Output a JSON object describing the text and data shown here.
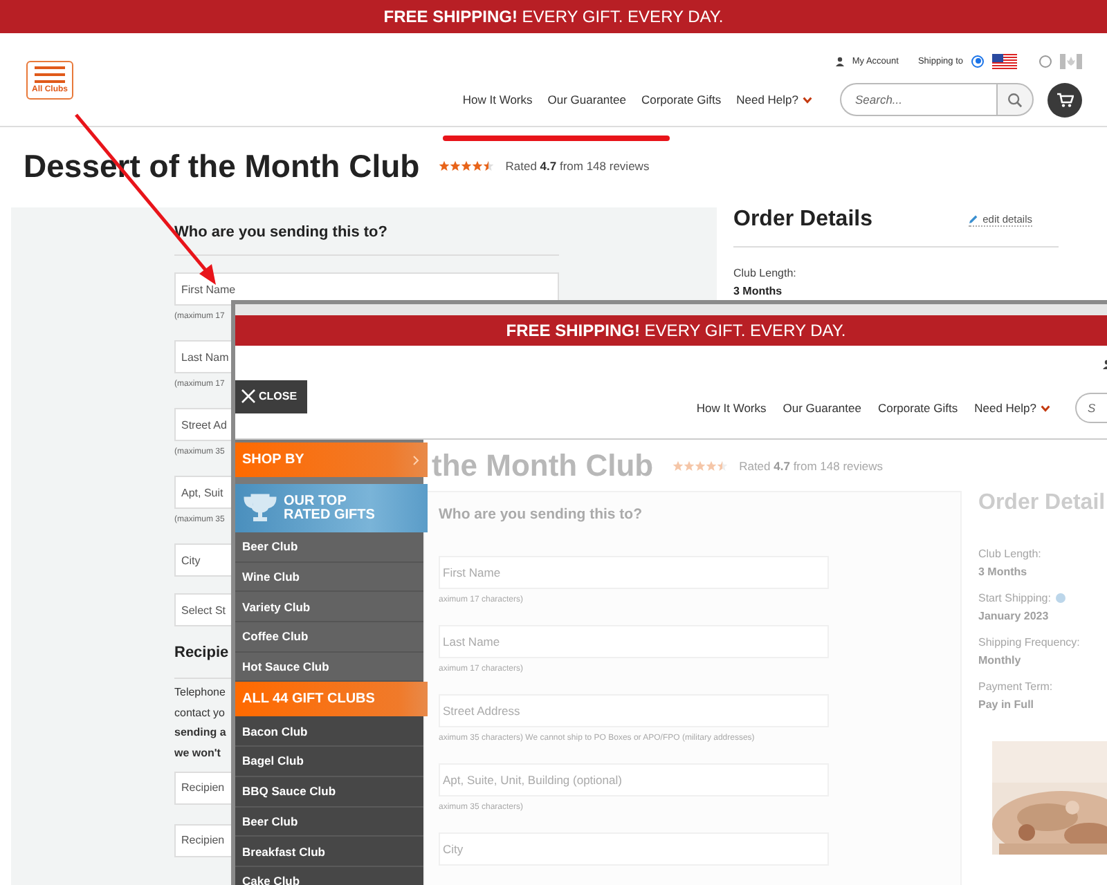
{
  "promo": "**FREE SHIPPING!** EVERY GIFT. EVERY DAY.",
  "header": {
    "menu_button": "All Clubs",
    "account": "My Account",
    "shipping_label": "Shipping to",
    "shipping_options": [
      {
        "kind": "us",
        "selected": true
      },
      {
        "kind": "ca",
        "selected": false
      }
    ],
    "nav": [
      "How It Works",
      "Our Guarantee",
      "Corporate Gifts",
      "Need Help?"
    ],
    "search": {
      "placeholder": "Search..."
    }
  },
  "title": "Dessert of the Month Club",
  "rating": {
    "stars": 4.5,
    "text": "Rated **4.7** from 148 reviews"
  },
  "form": {
    "heading": "Who are you sending this to?",
    "fields": [
      {
        "kind": "input",
        "placeholder": "First Name",
        "hint": "(maximum 17"
      },
      {
        "kind": "input",
        "placeholder": "Last Nam",
        "hint": "(maximum 17"
      },
      {
        "kind": "input",
        "placeholder": "Street Ad",
        "hint": "(maximum 35"
      },
      {
        "kind": "input",
        "placeholder": "Apt, Suit",
        "hint": "(maximum 35"
      },
      {
        "kind": "input",
        "placeholder": "City"
      },
      {
        "kind": "select",
        "placeholder": "Select St"
      }
    ],
    "section": "Recipie",
    "lines": [
      {
        "text": "Telephone",
        "bold": false
      },
      {
        "text": "contact yo",
        "bold": false
      },
      {
        "text": "sending a",
        "bold": true
      },
      {
        "text": "we won't",
        "bold": true
      }
    ],
    "recipient_fields": [
      {
        "placeholder": "Recipien"
      },
      {
        "placeholder": "Recipien"
      }
    ]
  },
  "order": {
    "title": "Order Details",
    "edit": "edit details",
    "details": [
      {
        "label": "Club Length:",
        "value": "3 Months"
      }
    ]
  },
  "overlay": {
    "promo": "**FREE SHIPPING!** EVERY GIFT. EVERY DAY.",
    "close": "CLOSE",
    "nav": [
      "How It Works",
      "Our Guarantee",
      "Corporate Gifts",
      "Need Help?"
    ],
    "search": {
      "placeholder": "S"
    },
    "menu": [
      {
        "kind": "shop",
        "label": "SHOP BY"
      },
      {
        "kind": "top",
        "label": "OUR TOP RATED GIFTS"
      },
      {
        "kind": "item",
        "label": "Beer Club"
      },
      {
        "kind": "item",
        "label": "Wine Club"
      },
      {
        "kind": "item",
        "label": "Variety Club"
      },
      {
        "kind": "item",
        "label": "Coffee Club"
      },
      {
        "kind": "item",
        "label": "Hot Sauce Club"
      },
      {
        "kind": "all",
        "label": "ALL 44 GIFT CLUBS"
      },
      {
        "kind": "dark",
        "label": "Bacon Club"
      },
      {
        "kind": "dark",
        "label": "Bagel Club"
      },
      {
        "kind": "dark",
        "label": "BBQ Sauce Club"
      },
      {
        "kind": "dark",
        "label": "Beer Club"
      },
      {
        "kind": "dark",
        "label": "Breakfast Club"
      },
      {
        "kind": "dark",
        "label": "Cake Club"
      }
    ],
    "title": "the Month Club",
    "rating": {
      "stars": 4.5,
      "text": "Rated **4.7** from 148 reviews"
    },
    "form": {
      "heading": "Who are you sending this to?",
      "fields": [
        {
          "placeholder": "First Name",
          "hint": "aximum 17 characters)"
        },
        {
          "placeholder": "Last Name",
          "hint": "aximum 17 characters)"
        },
        {
          "placeholder": "Street Address",
          "hint": "aximum 35 characters) We cannot ship to PO Boxes or APO/FPO (military addresses)"
        },
        {
          "placeholder": "Apt, Suite, Unit, Building (optional)",
          "hint": "aximum 35 characters)"
        },
        {
          "placeholder": "City"
        }
      ]
    },
    "order": {
      "title": "Order Detail",
      "details": [
        {
          "label": "Club Length:",
          "value": "3 Months",
          "help": false
        },
        {
          "label": "Start Shipping:",
          "value": "January 2023",
          "help": true
        },
        {
          "label": "Shipping Frequency:",
          "value": "Monthly",
          "help": false
        },
        {
          "label": "Payment Term:",
          "value": "Pay in Full",
          "help": false
        }
      ]
    }
  }
}
